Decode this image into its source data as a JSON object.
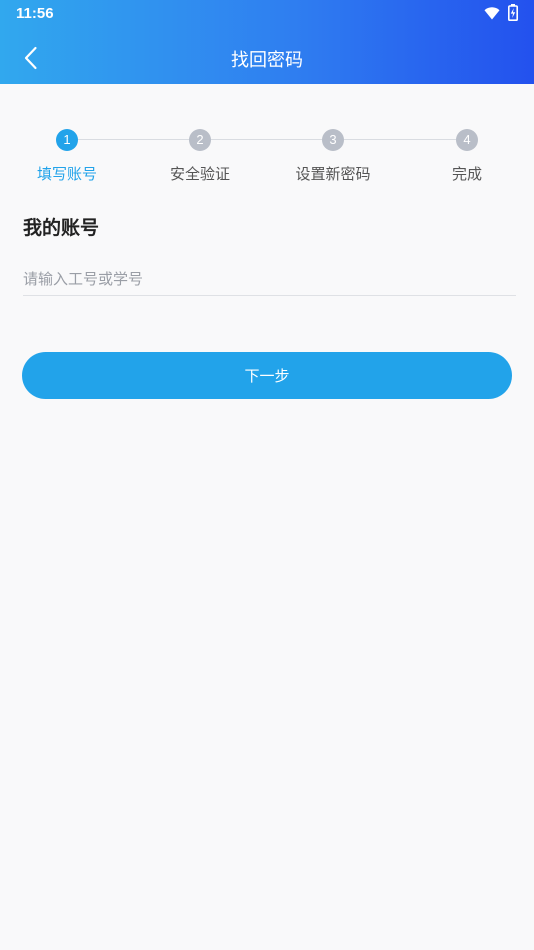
{
  "status_bar": {
    "time": "11:56",
    "icons": [
      "wifi-icon",
      "battery-charging-icon"
    ]
  },
  "nav": {
    "title": "找回密码",
    "back_icon": "chevron-left-icon"
  },
  "stepper": {
    "active_color": "#22a3ea",
    "inactive_color": "#b9bec8",
    "steps": [
      {
        "number": "1",
        "label": "填写账号",
        "state": "active"
      },
      {
        "number": "2",
        "label": "安全验证",
        "state": "inactive"
      },
      {
        "number": "3",
        "label": "设置新密码",
        "state": "inactive"
      },
      {
        "number": "4",
        "label": "完成",
        "state": "inactive"
      }
    ]
  },
  "form": {
    "section_title": "我的账号",
    "account_value": "",
    "account_placeholder": "请输入工号或学号",
    "next_label": "下一步"
  },
  "colors": {
    "header_gradient_start": "#31a8ee",
    "header_gradient_end": "#2351ee",
    "primary": "#22a3ea",
    "background": "#f9f9fa"
  }
}
